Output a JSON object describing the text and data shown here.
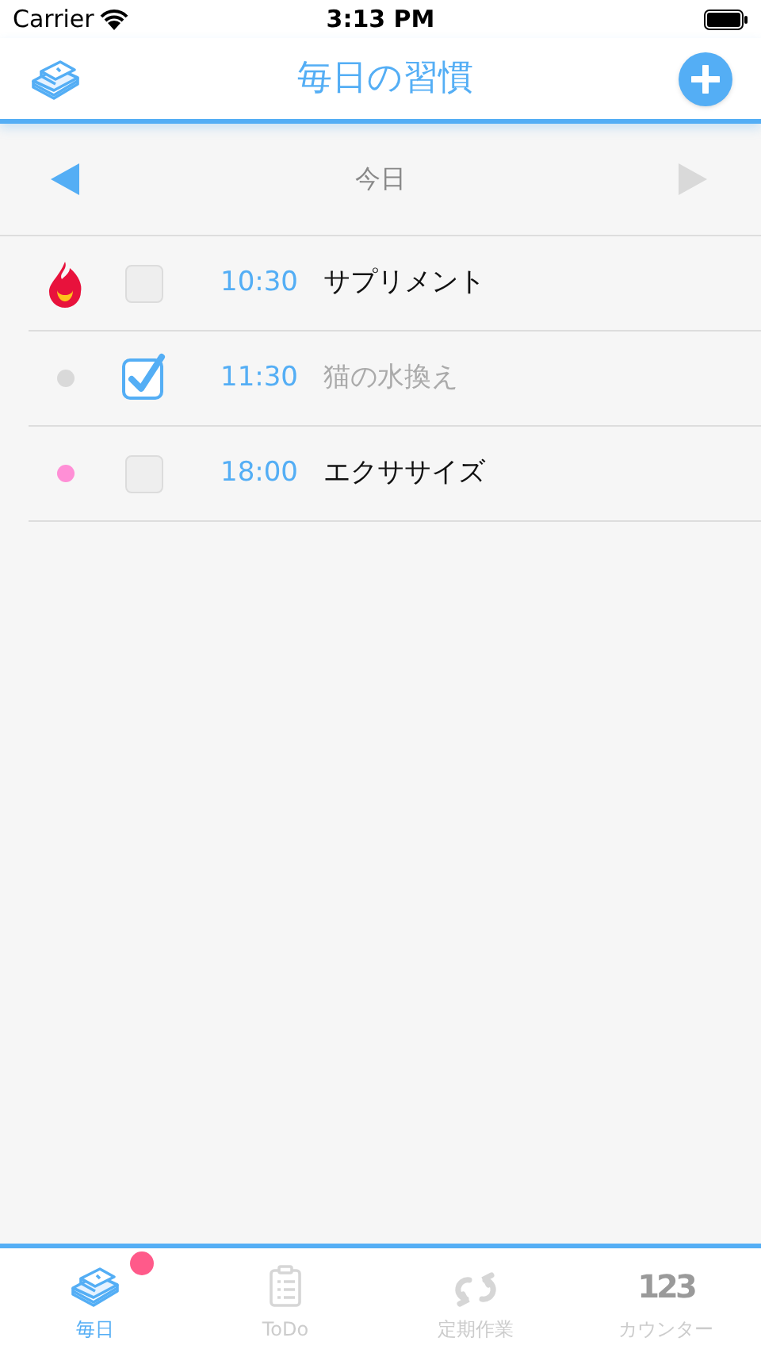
{
  "status_bar": {
    "carrier": "Carrier",
    "time": "3:13 PM"
  },
  "header": {
    "title": "毎日の習慣"
  },
  "date_nav": {
    "label": "今日",
    "prev_enabled": true,
    "next_enabled": false
  },
  "habits": [
    {
      "marker": {
        "kind": "flame"
      },
      "checked": false,
      "time": "10:30",
      "title": "サプリメント"
    },
    {
      "marker": {
        "kind": "dot",
        "color": "#d9d9d9"
      },
      "checked": true,
      "time": "11:30",
      "title": "猫の水換え"
    },
    {
      "marker": {
        "kind": "dot",
        "color": "#ff8fd6"
      },
      "checked": false,
      "time": "18:00",
      "title": "エクササイズ"
    }
  ],
  "tab_bar": [
    {
      "kind": "calendar",
      "label": "毎日",
      "selected": true,
      "badge": true
    },
    {
      "kind": "clipboard",
      "label": "ToDo",
      "selected": false,
      "badge": false
    },
    {
      "kind": "repeat",
      "label": "定期作業",
      "selected": false,
      "badge": false
    },
    {
      "kind": "numbers",
      "icon_text": "123",
      "label": "カウンター",
      "selected": false,
      "badge": false
    }
  ]
}
